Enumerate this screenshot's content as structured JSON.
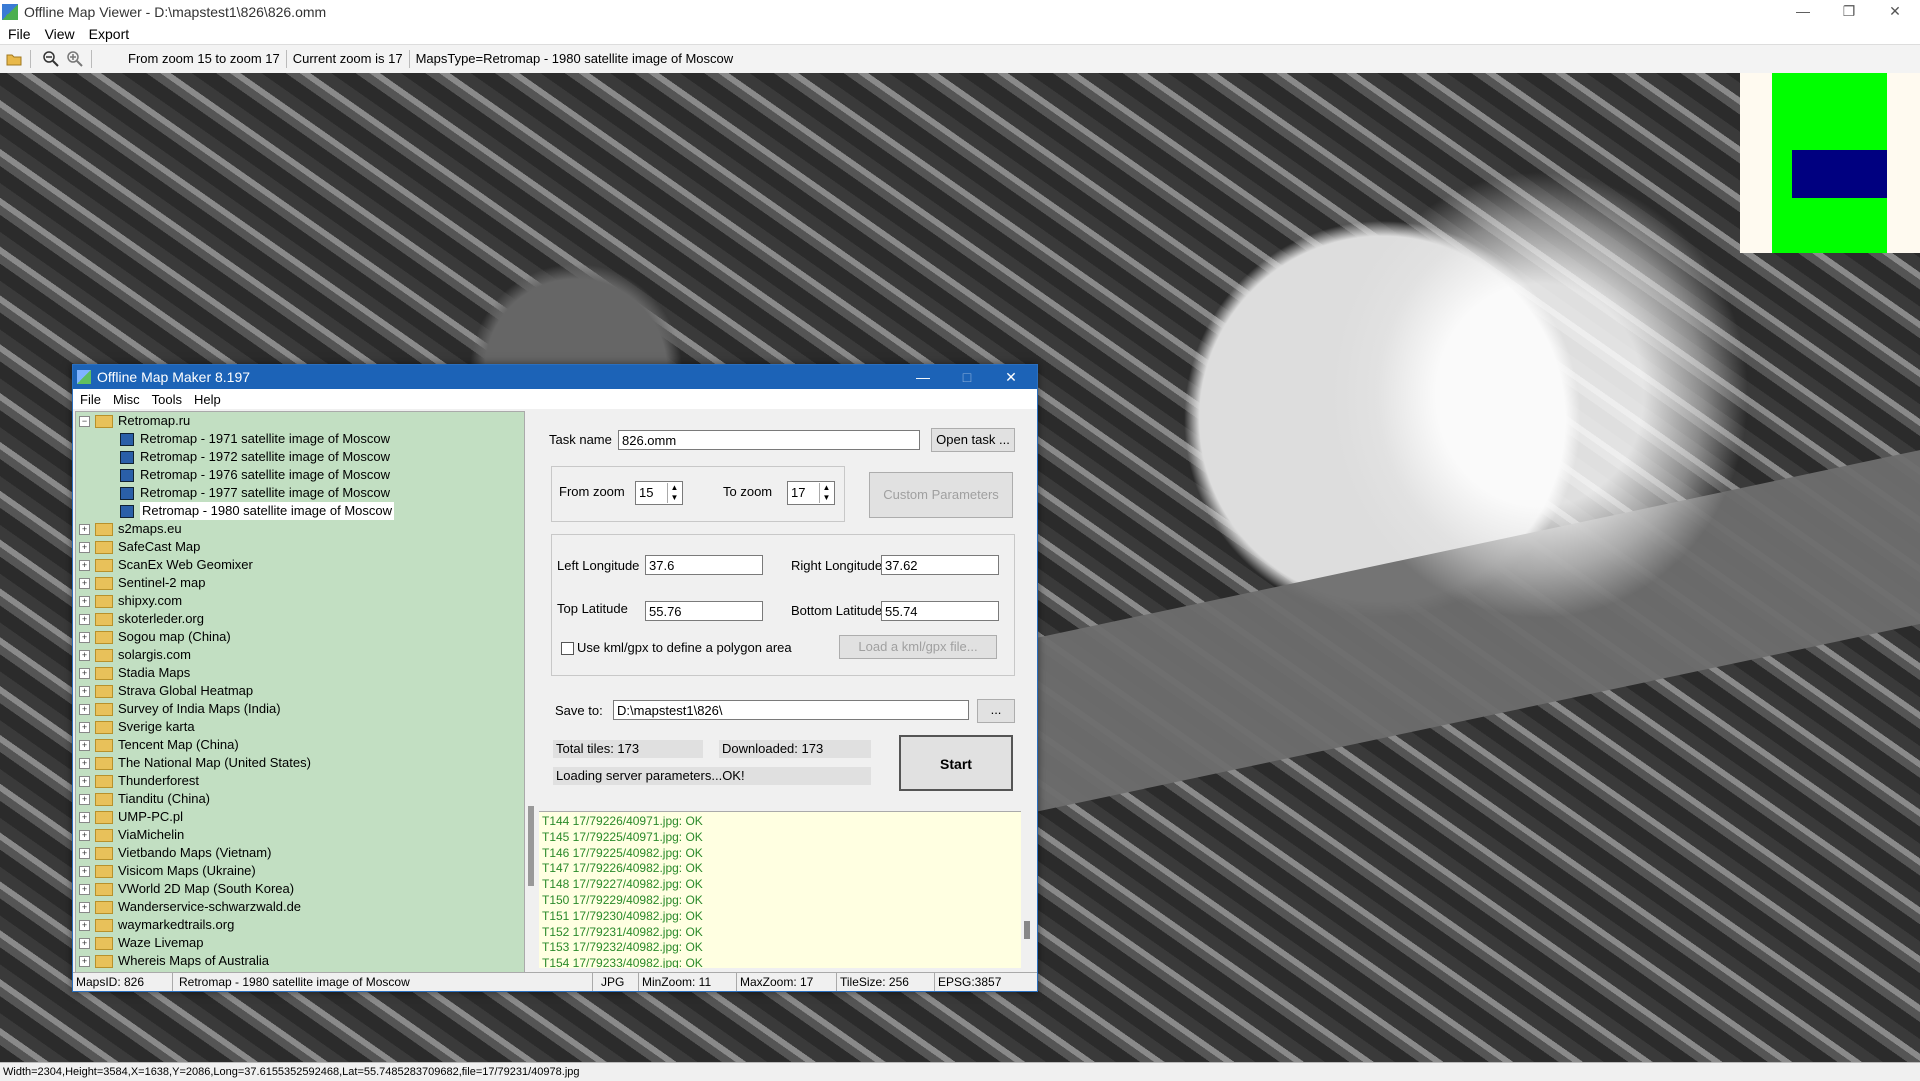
{
  "window": {
    "app_title": "Offline Map Viewer - D:\\mapstest1\\826\\826.omm",
    "controls": {
      "minimize": "—",
      "restore": "❐",
      "close": "✕"
    }
  },
  "menu": [
    "File",
    "View",
    "Export"
  ],
  "toolbar": {
    "icons": [
      "open-folder-icon",
      "zoom-out-icon",
      "zoom-in-icon"
    ],
    "zoom_range": "From zoom 15 to zoom 17",
    "current_zoom": "Current zoom is 17",
    "maps_type": "MapsType=Retromap - 1980 satellite image of Moscow"
  },
  "statusbar": "Width=2304,Height=3584,X=1638,Y=2086,Long=37.6155352592468,Lat=55.7485283709682,file=17/79231/40978.jpg",
  "dialog": {
    "title": "Offline Map Maker 8.197",
    "controls": {
      "minimize": "—",
      "maximize": "□",
      "close": "✕"
    },
    "menu": [
      "File",
      "Misc",
      "Tools",
      "Help"
    ],
    "tree": {
      "root": "Retromap.ru",
      "children": [
        "Retromap - 1971 satellite image of Moscow",
        "Retromap - 1972 satellite image of Moscow",
        "Retromap - 1976 satellite image of Moscow",
        "Retromap - 1977 satellite image of Moscow",
        "Retromap - 1980 satellite image of Moscow"
      ],
      "selected_child": 4,
      "providers": [
        "s2maps.eu",
        "SafeCast Map",
        "ScanEx Web Geomixer",
        "Sentinel-2 map",
        "shipxy.com",
        "skoterleder.org",
        "Sogou map (China)",
        "solargis.com",
        "Stadia Maps",
        "Strava Global Heatmap",
        "Survey of India Maps (India)",
        "Sverige karta",
        "Tencent Map (China)",
        "The National Map (United States)",
        "Thunderforest",
        "Tianditu (China)",
        "UMP-PC.pl",
        "ViaMichelin",
        "Vietbando Maps (Vietnam)",
        "Visicom Maps (Ukraine)",
        "VWorld 2D Map (South Korea)",
        "Wanderservice-schwarzwald.de",
        "waymarkedtrails.org",
        "Waze Livemap",
        "Whereis Maps of Australia"
      ]
    },
    "form": {
      "task_name_label": "Task name",
      "task_name_value": "826.omm",
      "open_task_button": "Open task ...",
      "from_zoom_label": "From zoom",
      "from_zoom_value": "15",
      "to_zoom_label": "To zoom",
      "to_zoom_value": "17",
      "custom_params_button": "Custom Parameters",
      "left_lon_label": "Left Longitude",
      "left_lon_value": "37.6",
      "right_lon_label": "Right Longitude",
      "right_lon_value": "37.62",
      "top_lat_label": "Top Latitude",
      "top_lat_value": "55.76",
      "bottom_lat_label": "Bottom Latitude",
      "bottom_lat_value": "55.74",
      "kml_checkbox_label": "Use kml/gpx to define a polygon area",
      "kml_checked": false,
      "load_kml_button": "Load a kml/gpx file...",
      "save_to_label": "Save to:",
      "save_to_value": "D:\\mapstest1\\826\\",
      "browse_button": "...",
      "total_tiles": "Total tiles: 173",
      "downloaded": "Downloaded: 173",
      "status_message": "Loading server parameters...OK!",
      "start_button": "Start"
    },
    "log": [
      "T144 17/79226/40971.jpg: OK",
      "T145 17/79225/40971.jpg: OK",
      "T146 17/79225/40982.jpg: OK",
      "T147 17/79226/40982.jpg: OK",
      "T148 17/79227/40982.jpg: OK",
      "T150 17/79229/40982.jpg: OK",
      "T151 17/79230/40982.jpg: OK",
      "T152 17/79231/40982.jpg: OK",
      "T153 17/79232/40982.jpg: OK",
      "T154 17/79233/40982.jpg: OK"
    ],
    "status": {
      "maps_id": "MapsID: 826",
      "map_name": "Retromap - 1980 satellite image of Moscow",
      "format": "JPG",
      "min_zoom": "MinZoom: 11",
      "max_zoom": "MaxZoom: 17",
      "tile_size": "TileSize: 256",
      "epsg": "EPSG:3857"
    }
  },
  "colors": {
    "tree_bg": "#c2dfc2",
    "log_bg": "#ffffe1",
    "log_text": "#2a8a2a",
    "dialog_title": "#1c63b7",
    "minimap_green": "#00ff00",
    "minimap_blue": "#000080"
  }
}
